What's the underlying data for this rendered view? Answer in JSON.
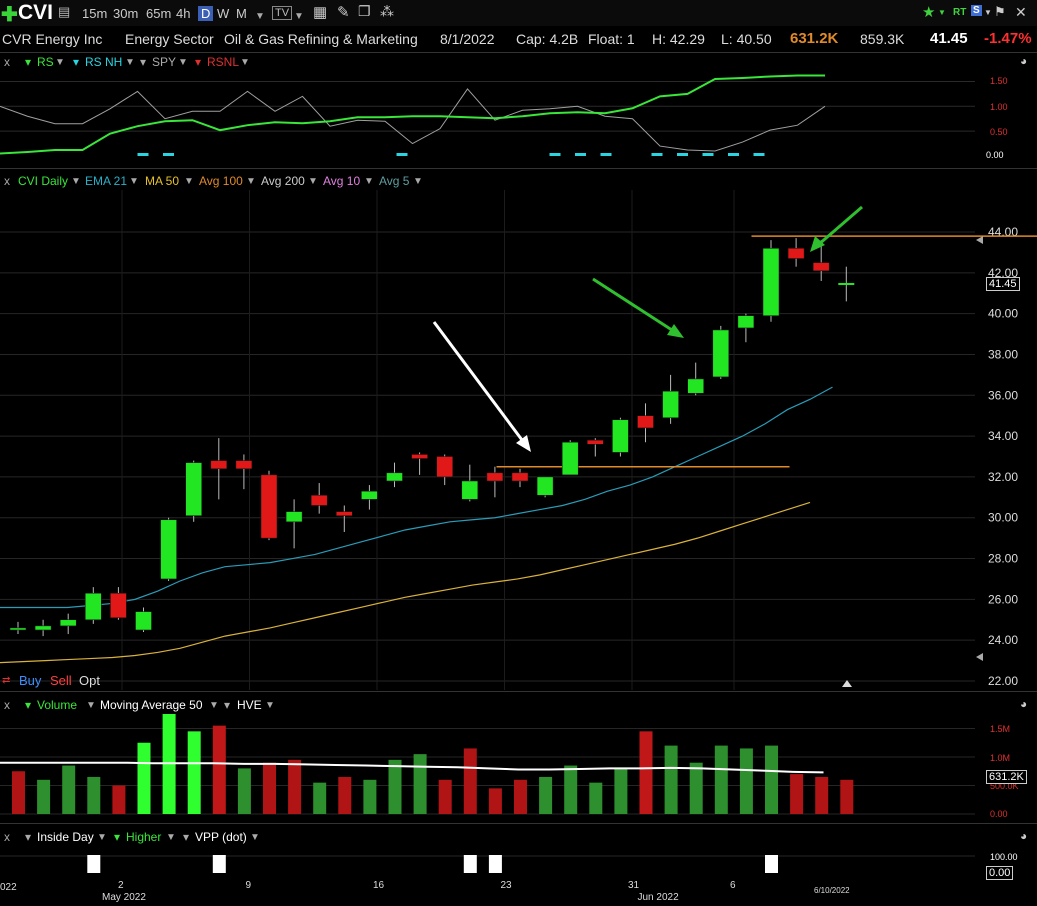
{
  "header": {
    "symbol": "CVI",
    "timeframes": [
      "15m",
      "30m",
      "65m",
      "4h",
      "D",
      "W",
      "M"
    ],
    "selected_timeframe": "D",
    "company": "CVR Energy Inc",
    "sector": "Energy Sector",
    "industry": "Oil & Gas Refining & Marketing",
    "date": "8/1/2022",
    "cap": "Cap: 4.2B",
    "float": "Float: 1",
    "high": "H: 42.29",
    "low": "L: 40.50",
    "volume": "631.2K",
    "avg_volume": "859.3K",
    "last": "41.45",
    "change": "-1.47%",
    "rt_label": "RT"
  },
  "rs_panel": {
    "x": "x",
    "items": [
      {
        "label": "RS",
        "color": "#39e639"
      },
      {
        "label": "RS NH",
        "color": "#2ad4e0"
      },
      {
        "label": "SPY",
        "color": "#aaaaaa"
      },
      {
        "label": "RSNL",
        "color": "#e03030"
      }
    ],
    "ticks": [
      "1.50",
      "1.00",
      "0.50"
    ],
    "current": "0.00",
    "rs_line": [
      0.05,
      0.08,
      0.12,
      0.12,
      0.45,
      0.6,
      0.7,
      0.72,
      0.52,
      0.62,
      0.68,
      0.66,
      0.7,
      0.78,
      0.78,
      0.8,
      0.8,
      0.78,
      0.76,
      0.8,
      0.86,
      0.88,
      0.86,
      0.96,
      1.2,
      1.25,
      1.55,
      1.57,
      1.6,
      1.62,
      1.62
    ],
    "spy_line": [
      1.0,
      0.8,
      0.65,
      0.65,
      0.95,
      1.3,
      0.75,
      0.9,
      0.9,
      1.3,
      0.9,
      1.2,
      0.6,
      0.72,
      0.7,
      0.25,
      0.55,
      1.35,
      0.72,
      0.92,
      0.95,
      1.0,
      0.8,
      0.75,
      0.2,
      0.12,
      0.1,
      0.28,
      0.52,
      0.62,
      1.0
    ],
    "rsnh_marks": [
      5,
      6,
      15,
      21,
      22,
      23,
      25,
      26,
      27,
      28,
      29
    ]
  },
  "price_panel": {
    "x": "x",
    "indicators": [
      {
        "label": "CVI Daily",
        "color": "#39e639"
      },
      {
        "label": "EMA 21",
        "color": "#2ab0c8"
      },
      {
        "label": "MA 50",
        "color": "#e6c229"
      },
      {
        "label": "Avg 100",
        "color": "#e08a2a"
      },
      {
        "label": "Avg 200",
        "color": "#cccccc"
      },
      {
        "label": "Avg 10",
        "color": "#e080e0"
      },
      {
        "label": "Avg 5",
        "color": "#5f9ea0"
      }
    ],
    "price_label": "41.45",
    "buy": "Buy",
    "sell": "Sell",
    "opt": "Opt"
  },
  "volume_panel": {
    "x": "x",
    "label": "Volume",
    "ma": "Moving Average 50",
    "hve": "HVE",
    "ticks": [
      "1.5M",
      "1.0M",
      "500.0K",
      "0.00"
    ],
    "current": "631.2K"
  },
  "signal_panel": {
    "x": "x",
    "inside_day": "Inside Day",
    "higher": "Higher",
    "vpp": "VPP (dot)",
    "ticks": [
      "100.00",
      "0.00"
    ],
    "current": "0.00"
  },
  "x_axis": {
    "labels": [
      {
        "text": "2",
        "slot": 4
      },
      {
        "text": "9",
        "slot": 9
      },
      {
        "text": "16",
        "slot": 14
      },
      {
        "text": "23",
        "slot": 19
      },
      {
        "text": "31",
        "slot": 24
      },
      {
        "text": "6",
        "slot": 28
      }
    ],
    "months": [
      {
        "text": "May 2022",
        "slot": 4
      },
      {
        "text": "Jun 2022",
        "slot": 25
      }
    ],
    "left_fragment": "022",
    "end_date": "6/10/2022"
  },
  "chart_data": {
    "type": "candlestick",
    "ylim": [
      22,
      45
    ],
    "y_ticks": [
      22,
      24,
      26,
      28,
      30,
      32,
      34,
      36,
      38,
      40,
      42,
      44
    ],
    "candles": [
      {
        "o": 24.5,
        "h": 24.9,
        "l": 24.3,
        "c": 24.6
      },
      {
        "o": 24.5,
        "h": 25.0,
        "l": 24.2,
        "c": 24.7
      },
      {
        "o": 24.7,
        "h": 25.3,
        "l": 24.3,
        "c": 25.0
      },
      {
        "o": 25.0,
        "h": 26.6,
        "l": 24.8,
        "c": 26.3
      },
      {
        "o": 26.3,
        "h": 26.6,
        "l": 25.0,
        "c": 25.1
      },
      {
        "o": 24.5,
        "h": 25.6,
        "l": 24.4,
        "c": 25.4
      },
      {
        "o": 27.0,
        "h": 30.0,
        "l": 26.9,
        "c": 29.9
      },
      {
        "o": 30.1,
        "h": 32.8,
        "l": 29.8,
        "c": 32.7
      },
      {
        "o": 32.8,
        "h": 33.9,
        "l": 30.9,
        "c": 32.4
      },
      {
        "o": 32.8,
        "h": 33.1,
        "l": 31.4,
        "c": 32.4
      },
      {
        "o": 32.1,
        "h": 32.3,
        "l": 28.9,
        "c": 29.0
      },
      {
        "o": 29.8,
        "h": 30.9,
        "l": 28.5,
        "c": 30.3
      },
      {
        "o": 31.1,
        "h": 31.7,
        "l": 30.2,
        "c": 30.6
      },
      {
        "o": 30.3,
        "h": 30.6,
        "l": 29.3,
        "c": 30.1
      },
      {
        "o": 30.9,
        "h": 31.6,
        "l": 30.4,
        "c": 31.3
      },
      {
        "o": 31.8,
        "h": 32.7,
        "l": 31.5,
        "c": 32.2
      },
      {
        "o": 33.1,
        "h": 33.2,
        "l": 32.1,
        "c": 32.9
      },
      {
        "o": 33.0,
        "h": 33.1,
        "l": 31.6,
        "c": 32.0
      },
      {
        "o": 30.9,
        "h": 32.6,
        "l": 30.8,
        "c": 31.8
      },
      {
        "o": 32.2,
        "h": 32.5,
        "l": 31.0,
        "c": 31.8
      },
      {
        "o": 32.2,
        "h": 32.4,
        "l": 31.5,
        "c": 31.8
      },
      {
        "o": 31.1,
        "h": 32.0,
        "l": 31.0,
        "c": 32.0
      },
      {
        "o": 32.1,
        "h": 33.8,
        "l": 32.1,
        "c": 33.7
      },
      {
        "o": 33.8,
        "h": 33.9,
        "l": 33.0,
        "c": 33.6
      },
      {
        "o": 33.2,
        "h": 34.9,
        "l": 33.0,
        "c": 34.8
      },
      {
        "o": 35.0,
        "h": 35.6,
        "l": 33.7,
        "c": 34.4
      },
      {
        "o": 34.9,
        "h": 37.0,
        "l": 34.6,
        "c": 36.2
      },
      {
        "o": 36.1,
        "h": 37.6,
        "l": 36.0,
        "c": 36.8
      },
      {
        "o": 36.9,
        "h": 39.4,
        "l": 36.8,
        "c": 39.2
      },
      {
        "o": 39.3,
        "h": 40.0,
        "l": 38.6,
        "c": 39.9
      },
      {
        "o": 39.9,
        "h": 43.6,
        "l": 39.6,
        "c": 43.2
      },
      {
        "o": 43.2,
        "h": 43.7,
        "l": 42.3,
        "c": 42.7
      },
      {
        "o": 42.5,
        "h": 43.6,
        "l": 41.6,
        "c": 42.1
      },
      {
        "o": 41.4,
        "h": 42.3,
        "l": 40.6,
        "c": 41.45
      }
    ],
    "ema21": [
      25.6,
      25.6,
      25.6,
      25.6,
      25.7,
      25.8,
      26.0,
      26.4,
      26.9,
      27.3,
      27.6,
      27.7,
      27.8,
      28.0,
      28.2,
      28.5,
      28.8,
      29.1,
      29.4,
      29.6,
      29.8,
      29.9,
      30.0,
      30.2,
      30.4,
      30.6,
      30.9,
      31.3,
      31.6,
      32.0,
      32.5,
      33.0,
      33.5,
      34.0,
      34.6,
      35.3,
      35.8,
      36.4
    ],
    "ma50": [
      22.9,
      22.95,
      23.0,
      23.05,
      23.1,
      23.15,
      23.25,
      23.4,
      23.6,
      23.9,
      24.2,
      24.4,
      24.6,
      24.85,
      25.1,
      25.35,
      25.6,
      25.85,
      26.1,
      26.3,
      26.5,
      26.7,
      26.85,
      27.0,
      27.2,
      27.45,
      27.7,
      27.95,
      28.2,
      28.45,
      28.7,
      29.0,
      29.35,
      29.7,
      30.05,
      30.4,
      30.75
    ],
    "resistance_lines": [
      {
        "price": 43.8,
        "from_slot": 29,
        "to_slot": 39,
        "color": "#e08a2a"
      },
      {
        "price": 32.5,
        "from_slot": 19,
        "to_slot": 29,
        "color": "#e08a2a"
      }
    ],
    "volume": [
      {
        "v": 0.75,
        "up": false
      },
      {
        "v": 0.6,
        "up": true
      },
      {
        "v": 0.85,
        "up": true
      },
      {
        "v": 0.65,
        "up": true
      },
      {
        "v": 0.5,
        "up": false
      },
      {
        "v": 1.25,
        "up": true
      },
      {
        "v": 1.85,
        "up": true
      },
      {
        "v": 1.45,
        "up": true
      },
      {
        "v": 1.55,
        "up": false
      },
      {
        "v": 0.8,
        "up": true
      },
      {
        "v": 0.9,
        "up": false
      },
      {
        "v": 0.95,
        "up": false
      },
      {
        "v": 0.55,
        "up": true
      },
      {
        "v": 0.65,
        "up": false
      },
      {
        "v": 0.6,
        "up": true
      },
      {
        "v": 0.95,
        "up": true
      },
      {
        "v": 1.05,
        "up": true
      },
      {
        "v": 0.6,
        "up": false
      },
      {
        "v": 1.15,
        "up": false
      },
      {
        "v": 0.45,
        "up": false
      },
      {
        "v": 0.6,
        "up": false
      },
      {
        "v": 0.65,
        "up": true
      },
      {
        "v": 0.85,
        "up": true
      },
      {
        "v": 0.55,
        "up": true
      },
      {
        "v": 0.8,
        "up": true
      },
      {
        "v": 1.45,
        "up": false
      },
      {
        "v": 1.2,
        "up": true
      },
      {
        "v": 0.9,
        "up": true
      },
      {
        "v": 1.2,
        "up": true
      },
      {
        "v": 1.15,
        "up": true
      },
      {
        "v": 1.2,
        "up": true
      },
      {
        "v": 0.7,
        "up": false
      },
      {
        "v": 0.65,
        "up": false
      },
      {
        "v": 0.6,
        "up": false
      }
    ],
    "volume_ma": [
      0.9,
      0.9,
      0.9,
      0.9,
      0.9,
      0.89,
      0.89,
      0.89,
      0.88,
      0.88,
      0.87,
      0.86,
      0.85,
      0.84,
      0.83,
      0.82,
      0.8,
      0.78,
      0.78,
      0.79,
      0.8,
      0.8,
      0.81,
      0.8,
      0.78,
      0.76,
      0.74,
      0.73
    ],
    "signals": [
      3,
      8,
      18,
      19,
      30
    ]
  }
}
